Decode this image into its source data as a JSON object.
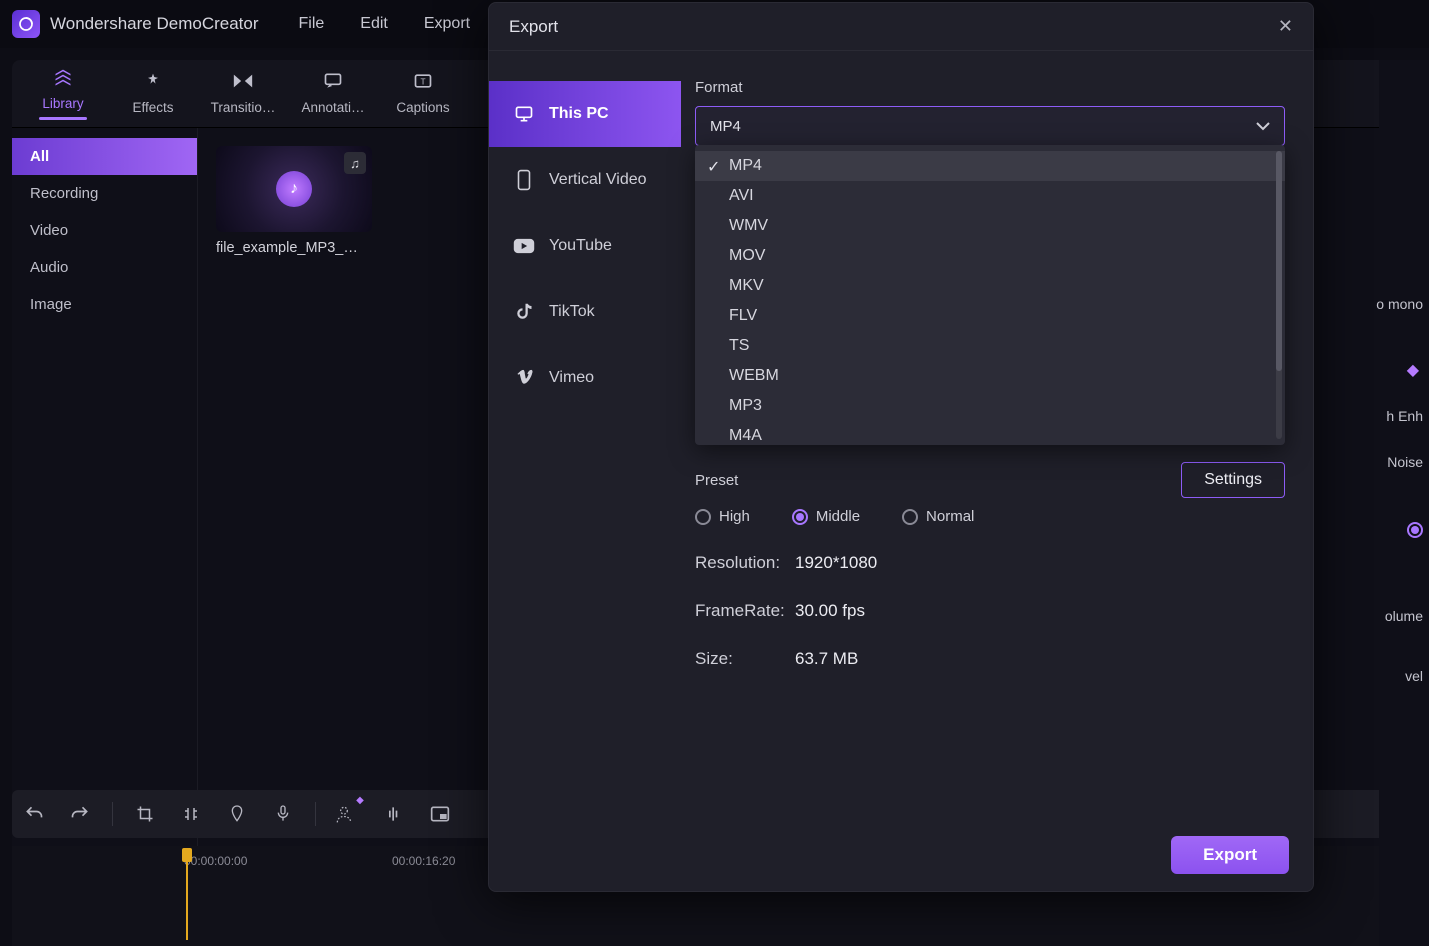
{
  "app": {
    "title": "Wondershare DemoCreator",
    "menus": [
      "File",
      "Edit",
      "Export"
    ]
  },
  "tabs": [
    {
      "label": "Library",
      "active": true
    },
    {
      "label": "Effects"
    },
    {
      "label": "Transitio…"
    },
    {
      "label": "Annotati…"
    },
    {
      "label": "Captions"
    }
  ],
  "sidebar": {
    "items": [
      {
        "label": "All",
        "active": true
      },
      {
        "label": "Recording"
      },
      {
        "label": "Video"
      },
      {
        "label": "Audio"
      },
      {
        "label": "Image"
      }
    ]
  },
  "media": {
    "filename": "file_example_MP3_…"
  },
  "timeline": {
    "t0": "00:00:00:00",
    "t1": "00:00:16:20"
  },
  "right_panel": {
    "items": [
      "o mono",
      "h Enh",
      "Noise",
      "olume",
      "vel"
    ]
  },
  "export_modal": {
    "title": "Export",
    "targets": [
      {
        "label": "This PC",
        "active": true,
        "icon": "monitor"
      },
      {
        "label": "Vertical Video",
        "icon": "phone"
      },
      {
        "label": "YouTube",
        "icon": "youtube"
      },
      {
        "label": "TikTok",
        "icon": "tiktok"
      },
      {
        "label": "Vimeo",
        "icon": "vimeo"
      }
    ],
    "format_label": "Format",
    "format_value": "MP4",
    "format_options": [
      "MP4",
      "AVI",
      "WMV",
      "MOV",
      "MKV",
      "FLV",
      "TS",
      "WEBM",
      "MP3",
      "M4A"
    ],
    "preset_label": "Preset",
    "settings_label": "Settings",
    "presets": [
      {
        "label": "High",
        "selected": false
      },
      {
        "label": "Middle",
        "selected": true
      },
      {
        "label": "Normal",
        "selected": false
      }
    ],
    "resolution_label": "Resolution:",
    "resolution_value": "1920*1080",
    "framerate_label": "FrameRate:",
    "framerate_value": "30.00 fps",
    "size_label": "Size:",
    "size_value": "63.7 MB",
    "export_btn": "Export"
  }
}
